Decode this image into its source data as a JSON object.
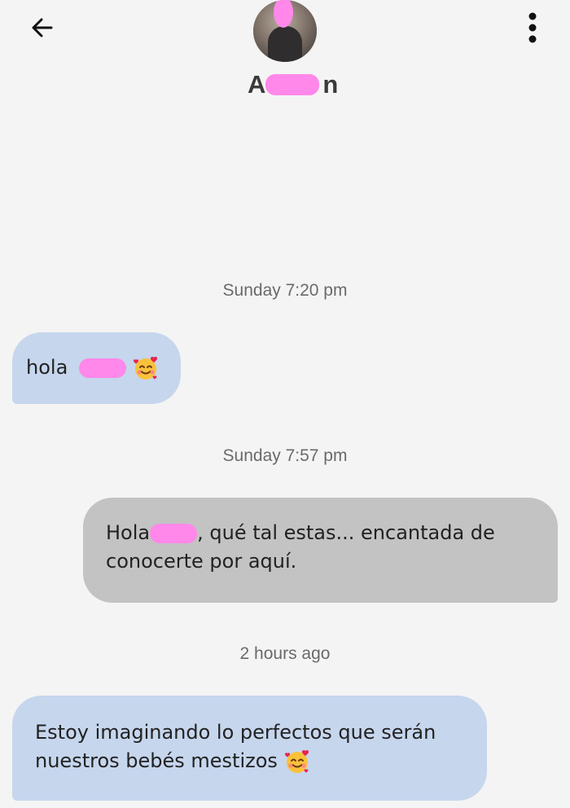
{
  "header": {
    "back_icon": "arrow-left-icon",
    "menu_icon": "more-vertical-icon",
    "contact_name": "A",
    "contact_name_tail": "n"
  },
  "messages": [
    {
      "timestamp": "Sunday 7:20 pm",
      "direction": "incoming",
      "text_before": "hola",
      "emoji": "smiling-face-with-hearts-icon"
    },
    {
      "timestamp": "Sunday 7:57 pm",
      "direction": "outgoing",
      "line1_before": "Hola",
      "line1_after": ", qué tal estas... encantada de",
      "line2": "conocerte por aquí."
    },
    {
      "timestamp": "2 hours ago",
      "direction": "incoming",
      "line1": "Estoy imaginando lo perfectos que serán",
      "line2": "nuestros bebés mestizos",
      "emoji": "smiling-face-with-hearts-icon"
    }
  ],
  "colors": {
    "background": "#f4f4f4",
    "incoming_bubble": "#c6d6ed",
    "outgoing_bubble": "#c3c3c3",
    "redaction": "#ff88ea",
    "timestamp_text": "#6a6a6a"
  }
}
